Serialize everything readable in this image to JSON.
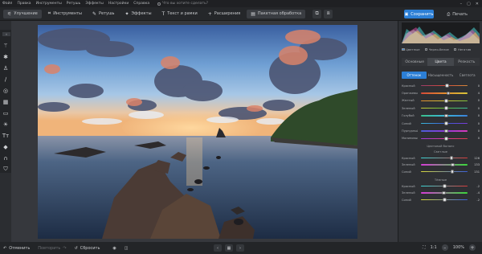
{
  "menu": {
    "items": [
      "Файл",
      "Правка",
      "Инструменты",
      "Ретушь",
      "Эффекты",
      "Настройки",
      "Справка"
    ],
    "search_placeholder": "Что вы хотите сделать?"
  },
  "toolbar": {
    "buttons": [
      {
        "label": "Улучшение",
        "icon": "sliders-icon"
      },
      {
        "label": "Инструменты",
        "icon": "crop-icon"
      },
      {
        "label": "Ретушь",
        "icon": "brush-icon"
      },
      {
        "label": "Эффекты",
        "icon": "sparkle-icon"
      },
      {
        "label": "Текст и рамки",
        "icon": "text-icon"
      },
      {
        "label": "Расширения",
        "icon": "plus-icon"
      },
      {
        "label": "Пакетная обработка",
        "icon": "batch-icon"
      }
    ],
    "save_label": "Сохранить",
    "print_label": "Печать"
  },
  "left_tools": [
    "wand-icon",
    "magic-icon",
    "stamp-icon",
    "brush-icon",
    "target-icon",
    "gradient-icon",
    "rect-icon",
    "sun-icon",
    "text-icon",
    "fill-icon",
    "magnet-icon",
    "shield-icon"
  ],
  "bottom": {
    "undo_label": "Отменить",
    "redo_label": "Повторить",
    "reset_label": "Сбросить",
    "zoom_ratio": "1:1",
    "zoom_value": "100%"
  },
  "panel": {
    "options": [
      "Цветные",
      "Черно-белое",
      "Негатив"
    ],
    "tabs": [
      "Основные",
      "Цвета",
      "Резкость"
    ],
    "active_tab": 1,
    "subtabs": [
      "Оттенок",
      "Насыщенность",
      "Светлота"
    ],
    "active_subtab": 0,
    "hue_rows": [
      {
        "label": "Красный",
        "value": "0"
      },
      {
        "label": "Оранжевый",
        "value": "4"
      },
      {
        "label": "Желтый",
        "value": "0"
      },
      {
        "label": "Зеленый",
        "value": "0"
      },
      {
        "label": "Голубой",
        "value": "0"
      },
      {
        "label": "Синий",
        "value": "0"
      },
      {
        "label": "Пурпурный",
        "value": "0"
      },
      {
        "label": "Малиновый",
        "value": "0"
      }
    ],
    "balance_title": "Цветовой баланс",
    "lights_title": "Светлые",
    "lights_rows": [
      {
        "label": "Красный",
        "value": "126"
      },
      {
        "label": "Зеленый",
        "value": "133"
      },
      {
        "label": "Синий",
        "value": "131"
      }
    ],
    "shadows_title": "Тёмные",
    "shadows_rows": [
      {
        "label": "Красный",
        "value": "-2"
      },
      {
        "label": "Зеленый",
        "value": "-4"
      },
      {
        "label": "Синий",
        "value": "-2"
      }
    ]
  }
}
